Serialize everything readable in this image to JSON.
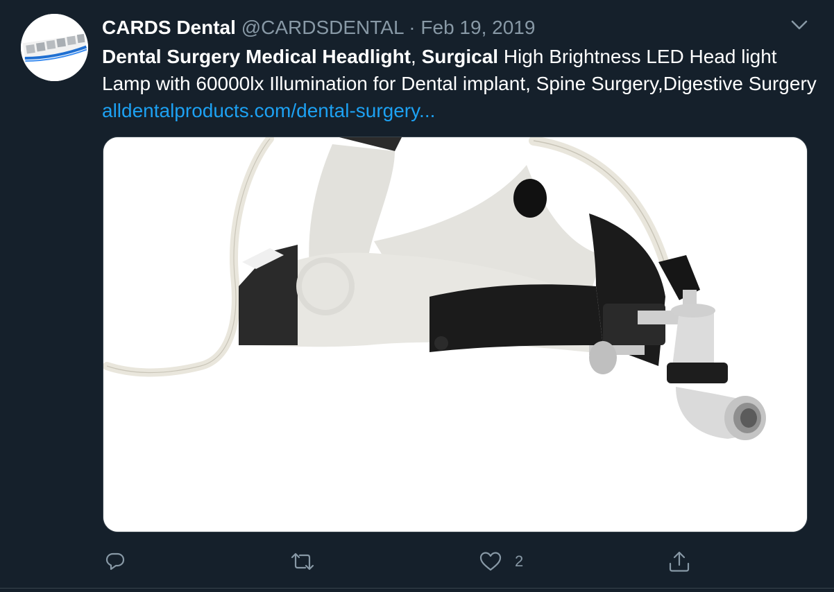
{
  "tweet": {
    "author_name": "CARDS Dental",
    "handle": "@CARDSDENTAL",
    "separator": "·",
    "date": "Feb 19, 2019",
    "text_bold_1": "Dental Surgery Medical Headlight",
    "text_comma": ", ",
    "text_bold_2": "Surgical",
    "text_rest": " High Brightness LED Head light Lamp with 60000lx Illumination for Dental implant, Spine Surgery,Digestive Surgery ",
    "link_text": "alldentalproducts.com/dental-surgery..."
  },
  "actions": {
    "reply_icon": "reply-icon",
    "retweet_icon": "retweet-icon",
    "like_icon": "heart-icon",
    "like_count": "2",
    "share_icon": "share-icon"
  },
  "colors": {
    "background": "#15202b",
    "secondary_text": "#8899a6",
    "link": "#1da1f2"
  }
}
